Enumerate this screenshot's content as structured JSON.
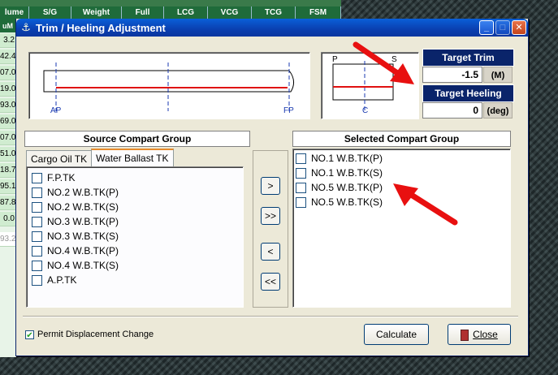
{
  "background": {
    "headers": [
      "lume",
      "S/G",
      "Weight",
      "Full",
      "LCG",
      "VCG",
      "TCG",
      "FSM"
    ],
    "row_values": [
      "uM",
      "3.2",
      "42.4",
      "07.0",
      "19.0",
      "93.0",
      "69.0",
      "07.0",
      "51.0",
      "18.7",
      "95.1",
      "87.8",
      "0.0",
      "93.2"
    ]
  },
  "dialog": {
    "title": "Trim / Heeling Adjustment",
    "target_trim_label": "Target Trim",
    "target_trim_value": "-1.5",
    "target_trim_unit": "(M)",
    "target_heeling_label": "Target Heeling",
    "target_heeling_value": "0",
    "target_heeling_unit": "(deg)"
  },
  "profile": {
    "ap_label": "AP",
    "fp_label": "FP"
  },
  "section": {
    "p_label": "P",
    "s_label": "S",
    "cl_label": "C"
  },
  "source": {
    "header": "Source Compart Group",
    "tabs": [
      "Cargo Oil TK",
      "Water Ballast TK"
    ],
    "items": [
      "F.P.TK",
      "NO.2 W.B.TK(P)",
      "NO.2 W.B.TK(S)",
      "NO.3 W.B.TK(P)",
      "NO.3 W.B.TK(S)",
      "NO.4 W.B.TK(P)",
      "NO.4 W.B.TK(S)",
      "A.P.TK"
    ]
  },
  "selected": {
    "header": "Selected Compart Group",
    "items": [
      "NO.1 W.B.TK(P)",
      "NO.1 W.B.TK(S)",
      "NO.5 W.B.TK(P)",
      "NO.5 W.B.TK(S)"
    ]
  },
  "transfer_buttons": [
    ">",
    ">>",
    "<",
    "<<"
  ],
  "footer": {
    "permit_label": "Permit Displacement Change",
    "permit_checked": true,
    "calculate_label": "Calculate",
    "close_label": "Close"
  },
  "colors": {
    "annotation_arrow": "#e81010",
    "title_bar": "#0a3fb0",
    "target_header": "#0a246a"
  }
}
